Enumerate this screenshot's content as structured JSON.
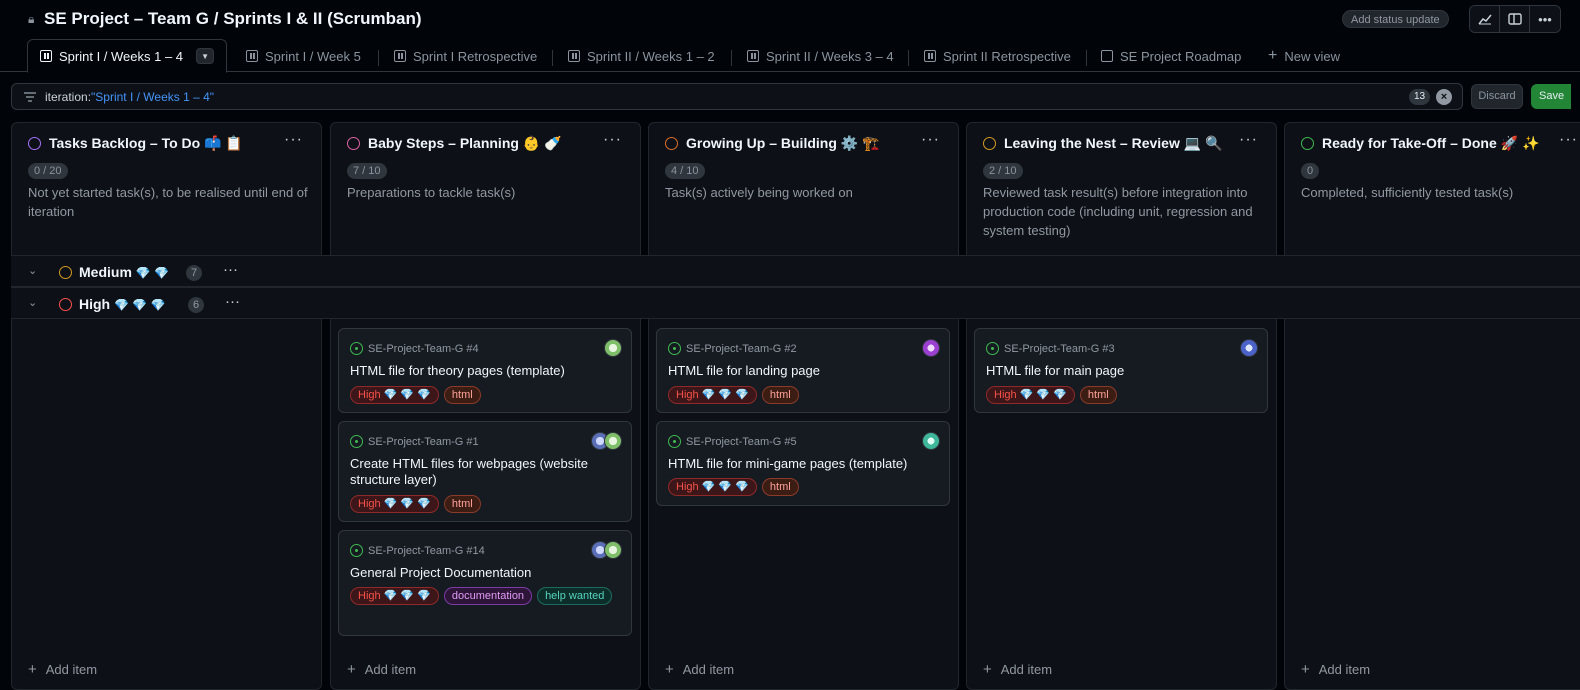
{
  "header": {
    "title": "SE Project – Team G / Sprints I & II (Scrumban)",
    "status_button": "Add status update",
    "lock_icon": "lock-icon",
    "icons": [
      "insights-icon",
      "layout-sidebar-icon",
      "kebab-horizontal-icon"
    ]
  },
  "tabs": [
    {
      "label": "Sprint I / Weeks 1 – 4",
      "icon": "board-icon"
    },
    {
      "label": "Sprint I / Week 5",
      "icon": "board-icon"
    },
    {
      "label": "Sprint I Retrospective",
      "icon": "board-icon"
    },
    {
      "label": "Sprint II / Weeks 1 – 2",
      "icon": "board-icon"
    },
    {
      "label": "Sprint II / Weeks 3 – 4",
      "icon": "board-icon"
    },
    {
      "label": "Sprint II Retrospective",
      "icon": "board-icon"
    },
    {
      "label": "SE Project Roadmap",
      "icon": "roadmap-icon"
    },
    {
      "label": "New view",
      "icon": "plus-icon"
    }
  ],
  "filter": {
    "prefix": "iteration:",
    "query": "\"Sprint I / Weeks 1 – 4\"",
    "count": "13",
    "discard_label": "Discard",
    "save_label": "Save"
  },
  "columns": [
    {
      "name": "Tasks Backlog – To Do 📫 📋",
      "count": "0 / 20",
      "desc": "Not yet started task(s), to be realised until end of iteration",
      "color": "#a371f7",
      "add": "Add item"
    },
    {
      "name": "Baby Steps – Planning 👶 🍼",
      "count": "7 / 10",
      "desc": "Preparations to tackle task(s)",
      "color": "#db61a2",
      "add": "Add item"
    },
    {
      "name": "Growing Up – Building ⚙️ 🏗️",
      "count": "4 / 10",
      "desc": "Task(s) actively being worked on",
      "color": "#db6d28",
      "add": "Add item"
    },
    {
      "name": "Leaving the Nest – Review 💻 🔍",
      "count": "2 / 10",
      "desc": "Reviewed task result(s) before integration into production code (including unit, regression and system testing)",
      "color": "#d29922",
      "add": "Add item"
    },
    {
      "name": "Ready for Take-Off – Done 🚀 ✨",
      "count": "0",
      "desc": "Completed, sufficiently tested task(s)",
      "color": "#3fb950",
      "add": "Add item"
    }
  ],
  "groups": [
    {
      "name": "Medium",
      "gems": "💎 💎",
      "count": "7",
      "color": "#d29922"
    },
    {
      "name": "High",
      "gems": "💎 💎 💎",
      "count": "6",
      "color": "#f85149"
    }
  ],
  "cards": [
    {
      "repo": "SE-Project-Team-G #4",
      "title": "HTML file for theory pages (template)",
      "labels": [
        "High 💎 💎 💎",
        "html"
      ]
    },
    {
      "repo": "SE-Project-Team-G #1",
      "title": "Create HTML files for webpages (website structure layer)",
      "labels": [
        "High 💎 💎 💎",
        "html"
      ]
    },
    {
      "repo": "SE-Project-Team-G #14",
      "title": "General Project Documentation",
      "labels": [
        "High 💎 💎 💎",
        "documentation",
        "help wanted"
      ]
    },
    {
      "repo": "SE-Project-Team-G #2",
      "title": "HTML file for landing page",
      "labels": [
        "High 💎 💎 💎",
        "html"
      ]
    },
    {
      "repo": "SE-Project-Team-G #5",
      "title": "HTML file for mini-game pages (template)",
      "labels": [
        "High 💎 💎 💎",
        "html"
      ]
    },
    {
      "repo": "SE-Project-Team-G #3",
      "title": "HTML file for main page",
      "labels": [
        "High 💎 💎 💎",
        "html"
      ]
    }
  ]
}
